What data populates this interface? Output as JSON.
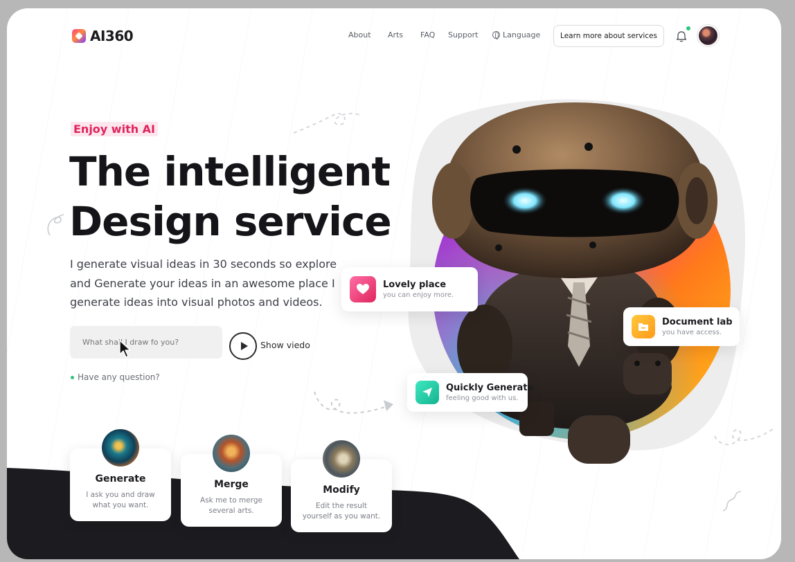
{
  "brand": {
    "name": "AI360"
  },
  "nav": {
    "items": [
      "About",
      "Arts",
      "FAQ",
      "Support"
    ],
    "language_label": "Language",
    "cta_label": "Learn more about services"
  },
  "hero": {
    "tag": "Enjoy with AI",
    "title_line1": "The intelligent",
    "title_line2": "Design service",
    "description": "I generate visual ideas in 30 seconds so explore and Generate your ideas in an awesome place I generate ideas into visual photos and videos.",
    "prompt_placeholder": "What shall I draw fo you?",
    "show_video_label": "Show viedo",
    "question_label": "Have any question?"
  },
  "floating_cards": [
    {
      "title": "Lovely place",
      "subtitle": "you can enjoy more."
    },
    {
      "title": "Document lab",
      "subtitle": "you have access."
    },
    {
      "title": "Quickly Generate",
      "subtitle": "feeling good with us."
    }
  ],
  "features": [
    {
      "title": "Generate",
      "desc_line1": "I ask you and draw",
      "desc_line2": "what you want."
    },
    {
      "title": "Merge",
      "desc_line1": "Ask me to merge",
      "desc_line2": "several arts."
    },
    {
      "title": "Modify",
      "desc_line1": "Edit the result",
      "desc_line2": "yourself as you want."
    }
  ],
  "icons": {
    "logo": "logo-icon",
    "language": "globe-icon",
    "notification": "bell-icon",
    "play": "play-icon",
    "lovely_place": "heart-icon",
    "document_lab": "folder-icon",
    "quickly_generate": "send-icon"
  },
  "colors": {
    "accent_pink": "#e0245e",
    "tag_background": "#fde7ee",
    "online_green": "#2ec27e",
    "dark_wave": "#1c1c20",
    "text_dark": "#151519"
  }
}
